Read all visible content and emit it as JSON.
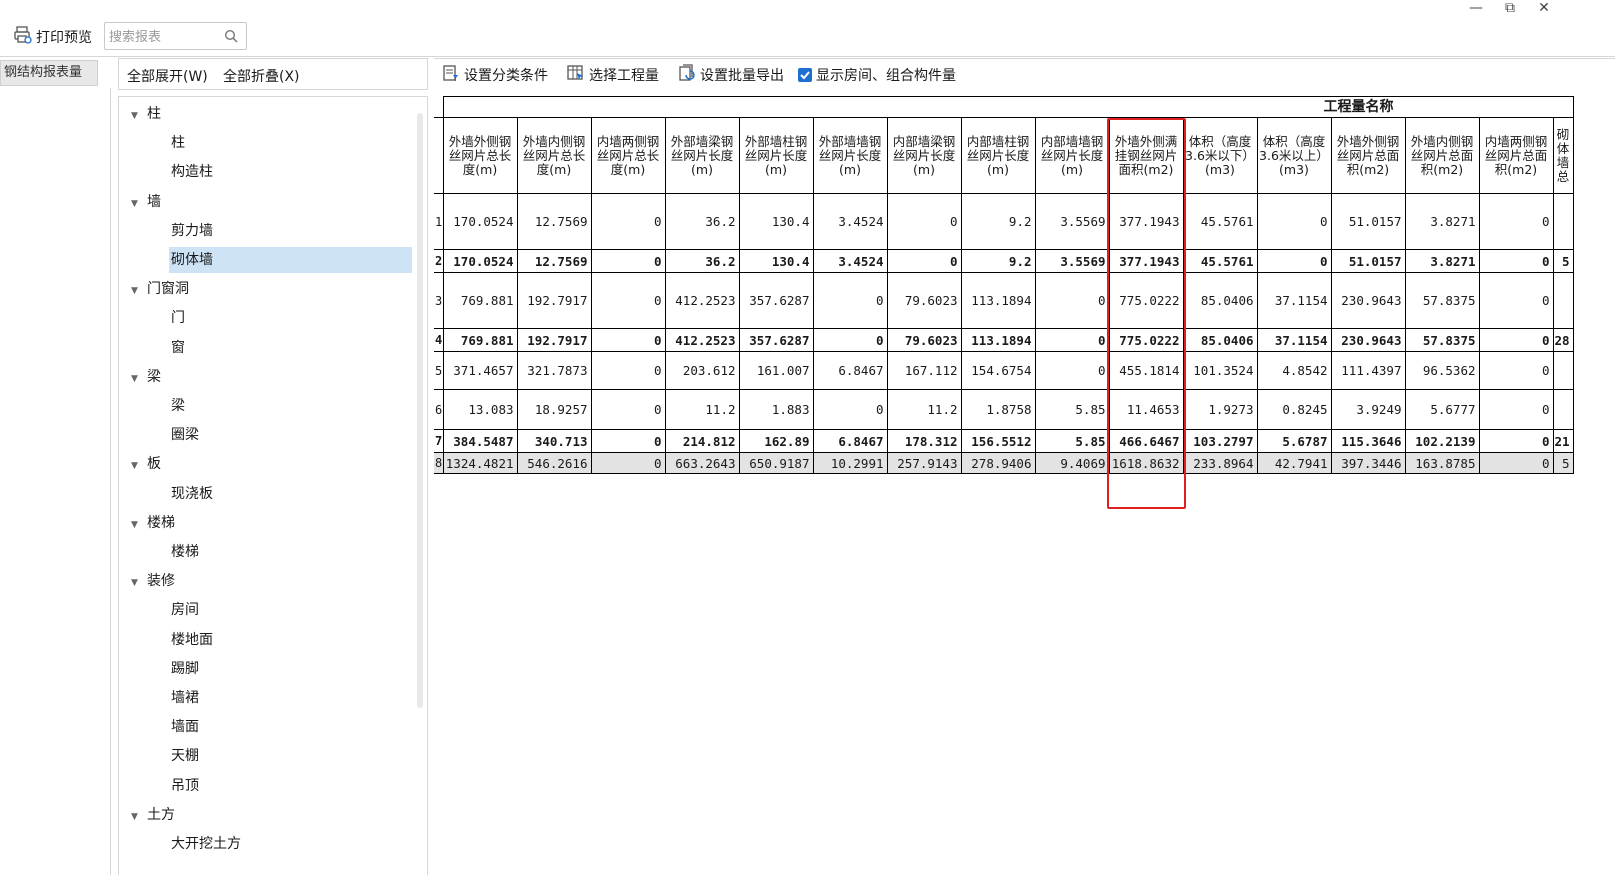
{
  "window": {
    "minimize": "—",
    "restore": "⧉",
    "close": "✕"
  },
  "toolbar": {
    "print_preview": "打印预览",
    "search_placeholder": "搜索报表"
  },
  "side_tab": "钢结构报表量",
  "tree_header": {
    "expand_all": "全部展开(W)",
    "collapse_all": "全部折叠(X)"
  },
  "tree": [
    {
      "label": "柱",
      "children": [
        "柱",
        "构造柱"
      ]
    },
    {
      "label": "墙",
      "children": [
        "剪力墙",
        "砌体墙"
      ]
    },
    {
      "label": "门窗洞",
      "children": [
        "门",
        "窗"
      ]
    },
    {
      "label": "梁",
      "children": [
        "梁",
        "圈梁"
      ]
    },
    {
      "label": "板",
      "children": [
        "现浇板"
      ]
    },
    {
      "label": "楼梯",
      "children": [
        "楼梯"
      ]
    },
    {
      "label": "装修",
      "children": [
        "房间",
        "楼地面",
        "踢脚",
        "墙裙",
        "墙面",
        "天棚",
        "吊顶"
      ]
    },
    {
      "label": "土方",
      "children": [
        "大开挖土方"
      ]
    }
  ],
  "tree_selected": "砌体墙",
  "main_toolbar": {
    "set_category": "设置分类条件",
    "select_quantity": "选择工程量",
    "batch_export": "设置批量导出",
    "show_rooms": "显示房间、组合构件量",
    "show_rooms_checked": true
  },
  "grid": {
    "group_title": "工程量名称",
    "columns": [
      "外墙外侧钢丝网片总长度(m)",
      "外墙内侧钢丝网片总长度(m)",
      "内墙两侧钢丝网片总长度(m)",
      "外部墙梁钢丝网片长度(m)",
      "外部墙柱钢丝网片长度(m)",
      "外部墙墙钢丝网片长度(m)",
      "内部墙梁钢丝网片长度(m)",
      "内部墙柱钢丝网片长度(m)",
      "内部墙墙钢丝网片长度(m)",
      "外墙外侧满挂钢丝网片面积(m2)",
      "体积（高度3.6米以下）(m3)",
      "体积（高度3.6米以上）(m3)",
      "外墙外侧钢丝网片总面积(m2)",
      "外墙内侧钢丝网片总面积(m2)",
      "内墙两侧钢丝网片总面积(m2)",
      "砌体墙总"
    ],
    "rows": [
      {
        "n": "1",
        "style": "normal",
        "cells": [
          "170.0524",
          "12.7569",
          "0",
          "36.2",
          "130.4",
          "3.4524",
          "0",
          "9.2",
          "3.5569",
          "377.1943",
          "45.5761",
          "0",
          "51.0157",
          "3.8271",
          "0",
          ""
        ]
      },
      {
        "n": "2",
        "style": "bold",
        "cells": [
          "170.0524",
          "12.7569",
          "0",
          "36.2",
          "130.4",
          "3.4524",
          "0",
          "9.2",
          "3.5569",
          "377.1943",
          "45.5761",
          "0",
          "51.0157",
          "3.8271",
          "0",
          "5"
        ]
      },
      {
        "n": "3",
        "style": "normal",
        "cells": [
          "769.881",
          "192.7917",
          "0",
          "412.2523",
          "357.6287",
          "0",
          "79.6023",
          "113.1894",
          "0",
          "775.0222",
          "85.0406",
          "37.1154",
          "230.9643",
          "57.8375",
          "0",
          ""
        ]
      },
      {
        "n": "4",
        "style": "bold",
        "cells": [
          "769.881",
          "192.7917",
          "0",
          "412.2523",
          "357.6287",
          "0",
          "79.6023",
          "113.1894",
          "0",
          "775.0222",
          "85.0406",
          "37.1154",
          "230.9643",
          "57.8375",
          "0",
          "28"
        ]
      },
      {
        "n": "5",
        "style": "normal",
        "cells": [
          "371.4657",
          "321.7873",
          "0",
          "203.612",
          "161.007",
          "6.8467",
          "167.112",
          "154.6754",
          "0",
          "455.1814",
          "101.3524",
          "4.8542",
          "111.4397",
          "96.5362",
          "0",
          ""
        ]
      },
      {
        "n": "6",
        "style": "normal",
        "cells": [
          "13.083",
          "18.9257",
          "0",
          "11.2",
          "1.883",
          "0",
          "11.2",
          "1.8758",
          "5.85",
          "11.4653",
          "1.9273",
          "0.8245",
          "3.9249",
          "5.6777",
          "0",
          ""
        ]
      },
      {
        "n": "7",
        "style": "bold",
        "cells": [
          "384.5487",
          "340.713",
          "0",
          "214.812",
          "162.89",
          "6.8467",
          "178.312",
          "156.5512",
          "5.85",
          "466.6467",
          "103.2797",
          "5.6787",
          "115.3646",
          "102.2139",
          "0",
          "21"
        ]
      },
      {
        "n": "8",
        "style": "total",
        "cells": [
          "1324.4821",
          "546.2616",
          "0",
          "663.2643",
          "650.9187",
          "10.2991",
          "257.9143",
          "278.9406",
          "9.4069",
          "1618.8632",
          "233.8964",
          "42.7941",
          "397.3446",
          "163.8785",
          "0",
          "5"
        ]
      }
    ]
  }
}
